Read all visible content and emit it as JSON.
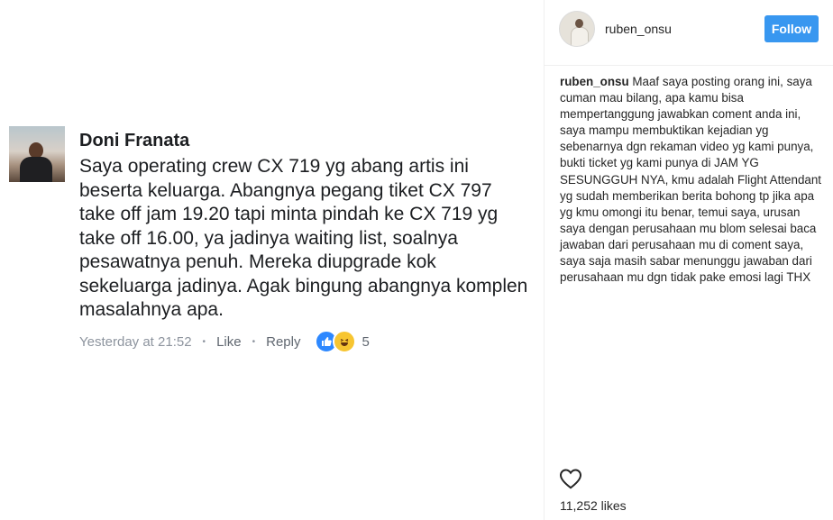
{
  "comment": {
    "author": "Doni Franata",
    "text": "Saya operating crew CX 719 yg abang artis ini beserta keluarga. Abangnya pegang tiket CX 797 take off jam 19.20 tapi minta pindah ke CX 719 yg take off 16.00, ya jadinya waiting list, soalnya pesawatnya penuh. Mereka diupgrade kok sekeluarga jadinya. Agak bingung abangnya komplen masalahnya apa.",
    "timestamp": "Yesterday at 21:52",
    "like_label": "Like",
    "reply_label": "Reply",
    "separator": "•",
    "reaction_count": "5",
    "reaction_icons": [
      "like-icon",
      "haha-icon"
    ]
  },
  "post": {
    "username": "ruben_onsu",
    "follow_label": "Follow",
    "caption_user": "ruben_onsu",
    "caption_text": "Maaf saya posting orang ini, saya cuman mau bilang, apa kamu bisa mempertanggung jawabkan coment anda ini, saya mampu membuktikan kejadian yg sebenarnya dgn rekaman video yg kami punya, bukti ticket yg kami punya di JAM YG SESUNGGUH NYA, kmu adalah Flight Attendant yg sudah memberikan berita bohong tp jika apa yg kmu omongi itu benar, temui saya, urusan saya dengan perusahaan mu blom selesai baca jawaban dari perusahaan mu di coment saya, saya saja masih sabar menunggu jawaban dari perusahaan mu dgn tidak pake emosi lagi THX",
    "likes_count": "11,252",
    "likes_label": "likes"
  },
  "colors": {
    "follow_button": "#3897f0",
    "fb_meta": "#8d949e",
    "like_reaction": "#2d88ff",
    "haha_reaction": "#f7c531"
  }
}
